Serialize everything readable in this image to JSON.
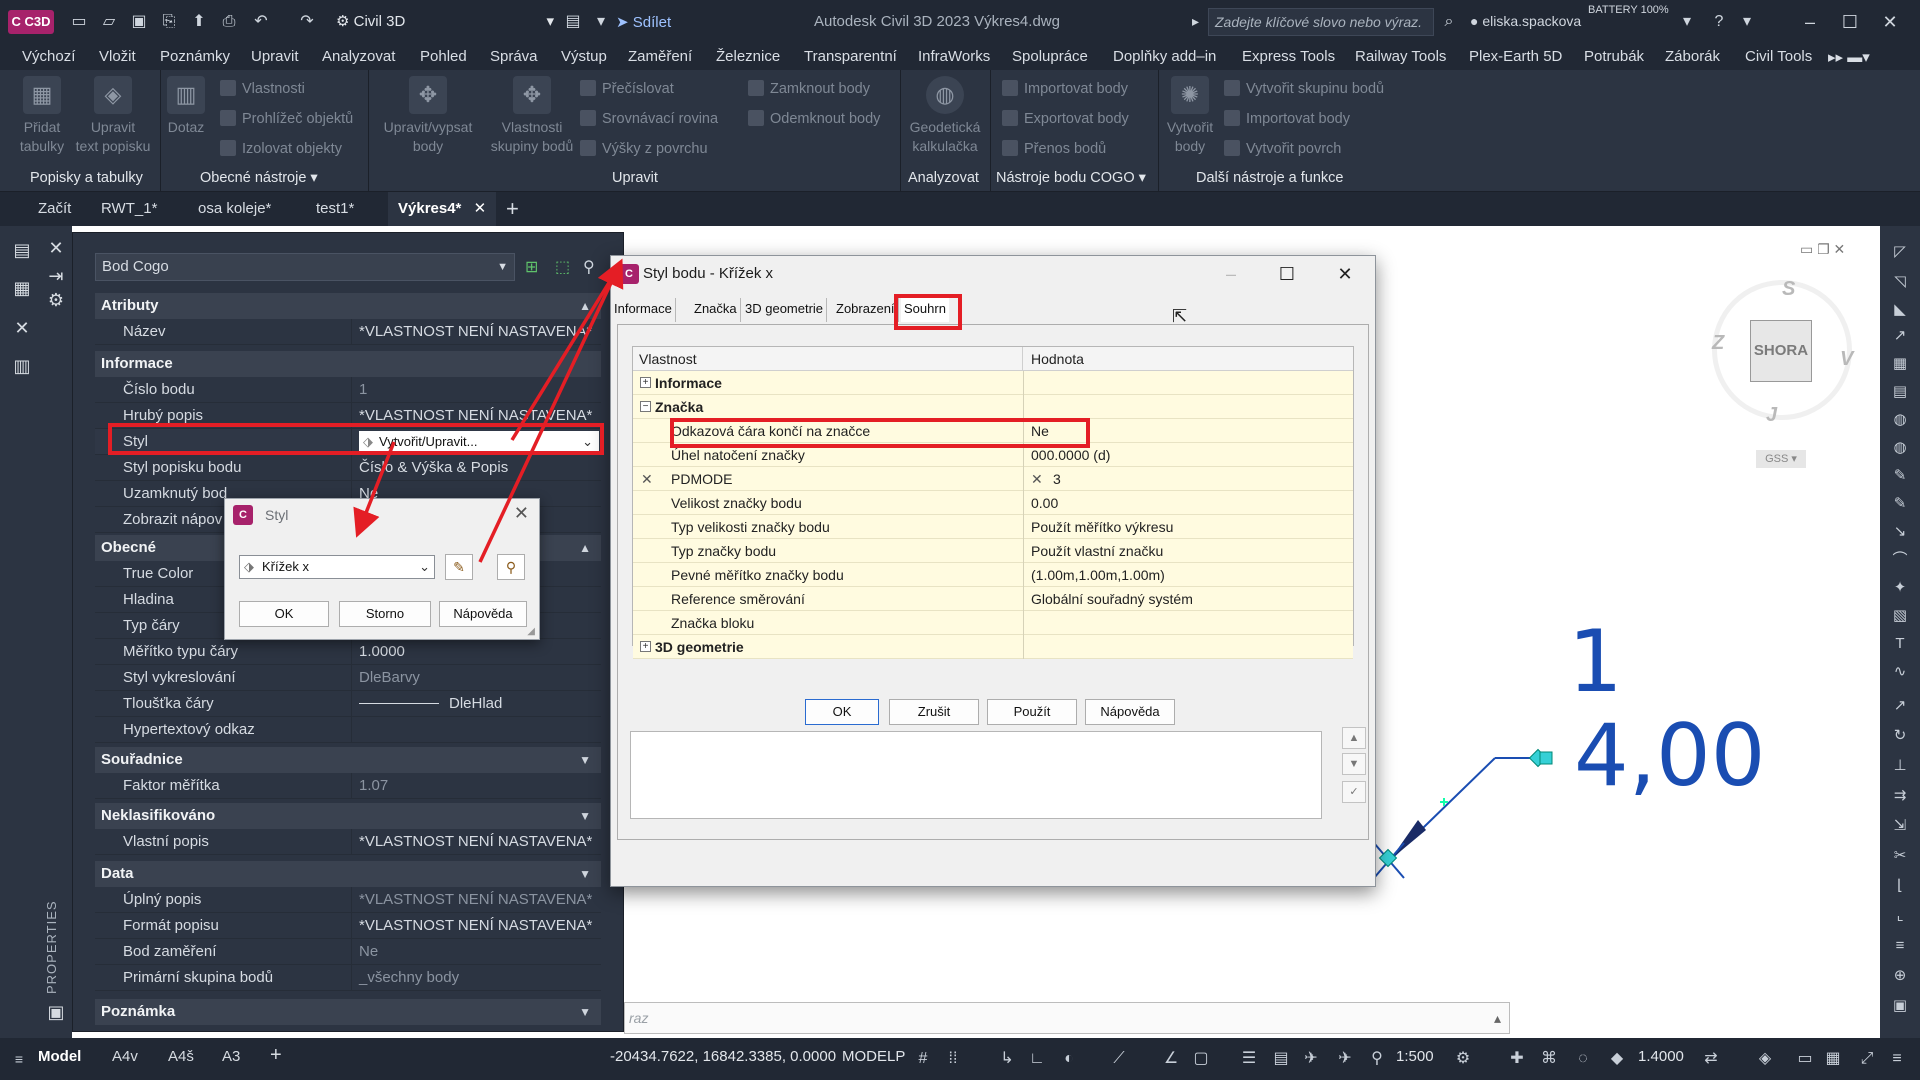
{
  "titlebar": {
    "app_logo": "C C3D",
    "workspace": "Civil 3D",
    "share": "Sdílet",
    "title": "Autodesk Civil 3D 2023   Výkres4.dwg",
    "search_placeholder": "Zadejte klíčové slovo nebo výraz.",
    "user": "eliska.spackova",
    "battery": "BATTERY 100%"
  },
  "menu": [
    "Výchozí",
    "Vložit",
    "Poznámky",
    "Upravit",
    "Analyzovat",
    "Pohled",
    "Správa",
    "Výstup",
    "Zaměření",
    "Železnice",
    "Transparentní",
    "InfraWorks",
    "Spolupráce",
    "Doplňky add–in",
    "Express Tools",
    "Railway Tools",
    "Plex-Earth 5D",
    "Potrubák",
    "Záborák",
    "Civil Tools"
  ],
  "ribbon": {
    "big_buttons": [
      {
        "label1": "Přidat",
        "label2": "tabulky"
      },
      {
        "label1": "Upravit",
        "label2": "text popisku"
      },
      {
        "label1": "Dotaz",
        "label2": ""
      },
      {
        "label1": "Upravit/vypsat",
        "label2": "body"
      },
      {
        "label1": "Vlastnosti",
        "label2": "skupiny bodů"
      },
      {
        "label1": "Geodetická",
        "label2": "kalkulačka"
      },
      {
        "label1": "Vytvořit",
        "label2": "body"
      }
    ],
    "small_buttons": [
      "Vlastnosti",
      "Prohlížeč objektů",
      "Izolovat objekty",
      "Přečíslovat",
      "Srovnávací rovina",
      "Výšky z povrchu",
      "Zamknout body",
      "Odemknout body",
      "Importovat body",
      "Exportovat body",
      "Přenos bodů",
      "Vytvořit skupinu bodů",
      "Importovat body",
      "Vytvořit povrch"
    ],
    "panels": [
      "Popisky a tabulky",
      "Obecné nástroje",
      "Upravit",
      "Analyzovat",
      "Nástroje bodu COGO",
      "Další nástroje a funkce"
    ]
  },
  "filetabs": [
    "Začít",
    "RWT_1*",
    "osa koleje*",
    "test1*",
    "Výkres4*"
  ],
  "palette": {
    "object_type": "Bod Cogo",
    "vertical_label": "PROPERTIES",
    "sections": {
      "atributy": "Atributy",
      "informace": "Informace",
      "obecne": "Obecné",
      "souradnice": "Souřadnice",
      "neklasifikovano": "Neklasifikováno",
      "data": "Data",
      "poznamka": "Poznámka"
    },
    "rows": {
      "nazev": {
        "name": "Název",
        "value": "*VLASTNOST NENÍ NASTAVENA*"
      },
      "cislo": {
        "name": "Číslo bodu",
        "value": "1"
      },
      "hruby": {
        "name": "Hrubý popis",
        "value": "*VLASTNOST NENÍ NASTAVENA*"
      },
      "styl": {
        "name": "Styl",
        "value": "Vytvořit/Upravit..."
      },
      "styl_popisku": {
        "name": "Styl popisku bodu",
        "value": "Číslo & Výška & Popis"
      },
      "uzamknuty": {
        "name": "Uzamknutý bod",
        "value": "Ne"
      },
      "zobrazit": {
        "name": "Zobrazit nápov",
        "value": ""
      },
      "truecolor": {
        "name": "True Color",
        "value": ""
      },
      "hladina": {
        "name": "Hladina",
        "value": ""
      },
      "typcary": {
        "name": "Typ čáry",
        "value": ""
      },
      "meritko": {
        "name": "Měřítko typu čáry",
        "value": "1.0000"
      },
      "styl_vykr": {
        "name": "Styl vykreslování",
        "value": "DleBarvy"
      },
      "tloustka": {
        "name": "Tloušťka čáry",
        "value": "DleHlad"
      },
      "hypertext": {
        "name": "Hypertextový odkaz",
        "value": ""
      },
      "faktor": {
        "name": "Faktor měřítka",
        "value": "1.07"
      },
      "vlastni": {
        "name": "Vlastní popis",
        "value": "*VLASTNOST NENÍ NASTAVENA*"
      },
      "uplny": {
        "name": "Úplný popis",
        "value": "*VLASTNOST NENÍ NASTAVENA*"
      },
      "format": {
        "name": "Formát popisu",
        "value": "*VLASTNOST NENÍ NASTAVENA*"
      },
      "bodzam": {
        "name": "Bod zaměření",
        "value": "Ne"
      },
      "primarni": {
        "name": "Primární skupina bodů",
        "value": "_všechny body"
      }
    }
  },
  "styl_dialog": {
    "title": "Styl",
    "selected": "Křížek x",
    "ok": "OK",
    "storno": "Storno",
    "help": "Nápověda"
  },
  "bodu_dialog": {
    "title": "Styl bodu - Křížek x",
    "tabs": [
      "Informace",
      "Značka",
      "3D geometrie",
      "Zobrazení",
      "Souhrn"
    ],
    "col_property": "Vlastnost",
    "col_value": "Hodnota",
    "groups": {
      "informace": "Informace",
      "znacka": "Značka",
      "geo": "3D geometrie"
    },
    "rows": [
      {
        "name": "Odkazová čára končí na značce",
        "value": "Ne"
      },
      {
        "name": "Úhel natočení značky",
        "value": "000.0000 (d)"
      },
      {
        "name": "PDMODE",
        "value": "3"
      },
      {
        "name": "Velikost značky bodu",
        "value": "0.00"
      },
      {
        "name": "Typ velikosti značky bodu",
        "value": "Použít měřítko výkresu"
      },
      {
        "name": "Typ značky bodu",
        "value": "Použít vlastní značku"
      },
      {
        "name": "Pevné měřítko značky bodu",
        "value": "(1.00m,1.00m,1.00m)"
      },
      {
        "name": "Reference směrování",
        "value": "Globální souřadný systém"
      },
      {
        "name": "Značka bloku",
        "value": ""
      }
    ],
    "buttons": {
      "ok": "OK",
      "cancel": "Zrušit",
      "apply": "Použít",
      "help": "Nápověda"
    }
  },
  "drawing": {
    "point_number": "1",
    "elevation": "4,00",
    "viewcube_face": "SHORA",
    "compass": {
      "n": "S",
      "w": "Z",
      "e": "V",
      "s": "J"
    },
    "ucs": "GSS",
    "command_placeholder": "raz"
  },
  "statusbar": {
    "layout_tabs": [
      "Model",
      "A4v",
      "A4š",
      "A3"
    ],
    "coords": "-20434.7622, 16842.3385, 0.0000",
    "space": "MODELP",
    "scale": "1:500",
    "lineweight": "1.4000"
  }
}
